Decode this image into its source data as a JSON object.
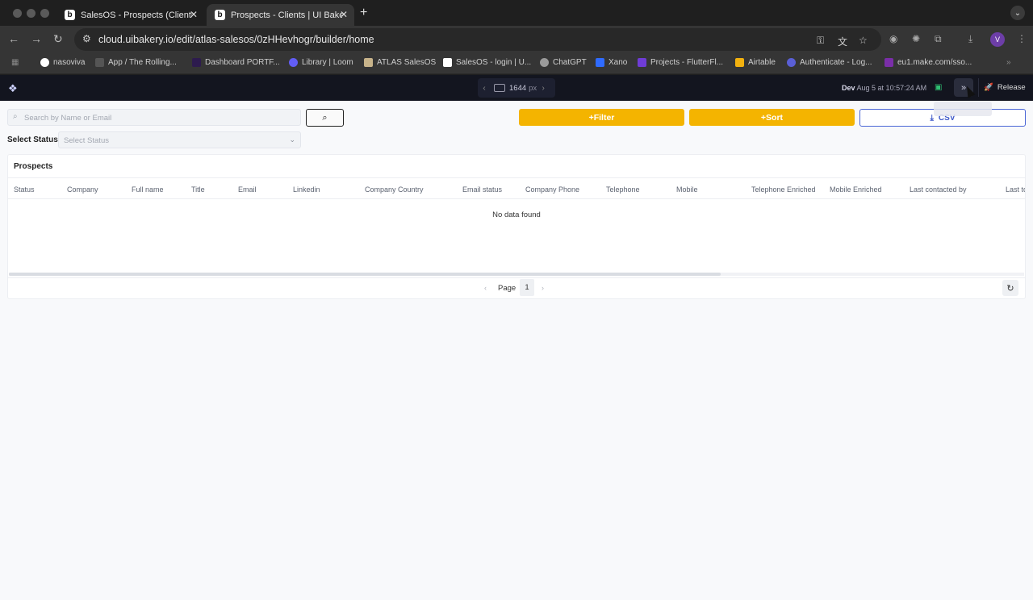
{
  "browser": {
    "tabs": [
      {
        "title": "SalesOS - Prospects (Clients)",
        "favicon": "b"
      },
      {
        "title": "Prospects - Clients | UI Baker",
        "favicon": "b"
      }
    ],
    "url": "cloud.uibakery.io/edit/atlas-salesos/0zHHevhogr/builder/home",
    "profile_initial": "V",
    "bookmarks": [
      {
        "label": "nasoviva",
        "color": "#ffffff"
      },
      {
        "label": "App / The Rolling...",
        "color": "#555555"
      },
      {
        "label": "Dashboard PORTF...",
        "color": "#2d1b4e"
      },
      {
        "label": "Library | Loom",
        "color": "#625df5"
      },
      {
        "label": "ATLAS SalesOS",
        "color": "#c7b38a"
      },
      {
        "label": "SalesOS - login | U...",
        "color": "#ffffff"
      },
      {
        "label": "ChatGPT",
        "color": "#9a9a9a"
      },
      {
        "label": "Xano",
        "color": "#2f6bff"
      },
      {
        "label": "Projects - FlutterFl...",
        "color": "#6f3cd6"
      },
      {
        "label": "Airtable",
        "color": "#f2b10f"
      },
      {
        "label": "Authenticate - Log...",
        "color": "#5a5fd6"
      },
      {
        "label": "eu1.make.com/sso...",
        "color": "#7a2ea8"
      }
    ]
  },
  "builder": {
    "viewport_value": "1644",
    "viewport_unit": "px",
    "env": "Dev",
    "saved_at": "Aug 5 at 10:57:24 AM",
    "release_label": "Release"
  },
  "app": {
    "search_placeholder": "Search by Name or Email",
    "filter_label": "+Filter",
    "sort_label": "+Sort",
    "csv_label": "CSV",
    "status_label": "Select Status",
    "status_placeholder": "Select Status",
    "table_title": "Prospects",
    "columns": [
      "Status",
      "Company",
      "Full name",
      "Title",
      "Email",
      "Linkedin",
      "Company Country",
      "Email status",
      "Company Phone",
      "Telephone",
      "Mobile",
      "Telephone Enriched",
      "Mobile Enriched",
      "Last contacted by",
      "Last to"
    ],
    "empty_text": "No data found",
    "page_label": "Page",
    "page_number": "1"
  },
  "colors": {
    "accent_yellow": "#f4b400",
    "csv_blue": "#3d58c9",
    "builder_bar": "#13151f"
  }
}
